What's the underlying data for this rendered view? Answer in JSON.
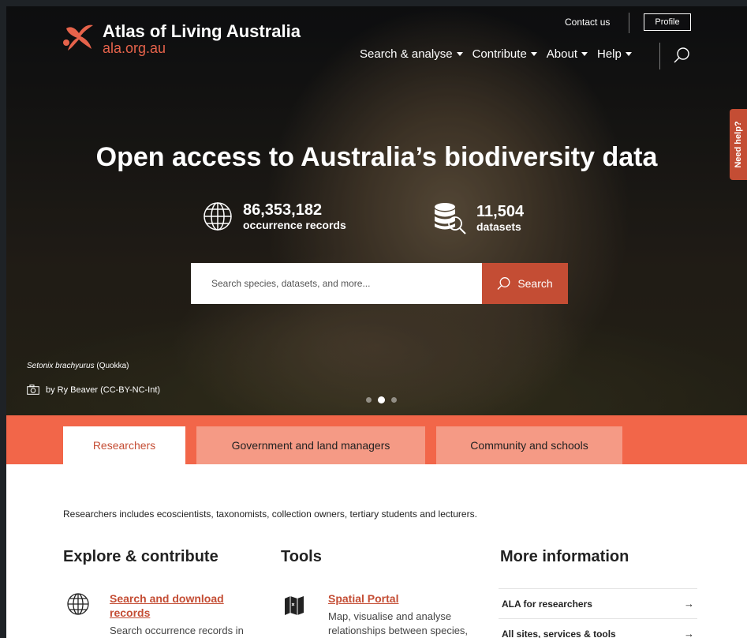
{
  "header": {
    "logo_title": "Atlas of Living Australia",
    "logo_subtitle": "ala.org.au",
    "contact_label": "Contact us",
    "profile_label": "Profile",
    "nav": [
      {
        "label": "Search & analyse"
      },
      {
        "label": "Contribute"
      },
      {
        "label": "About"
      },
      {
        "label": "Help"
      }
    ]
  },
  "hero": {
    "headline": "Open access to Australia’s biodiversity data",
    "stats": [
      {
        "number": "86,353,182",
        "label": "occurrence records",
        "icon": "globe-icon"
      },
      {
        "number": "11,504",
        "label": "datasets",
        "icon": "database-search-icon"
      }
    ],
    "search": {
      "placeholder": "Search species, datasets, and more...",
      "button_label": "Search"
    },
    "caption_species": "Setonix brachyurus",
    "caption_common": " (Quokka)",
    "caption_credit": "by Ry Beaver (CC-BY-NC-Int)",
    "slides": 3,
    "active_slide": 2
  },
  "need_help": "Need help?",
  "tabs": [
    {
      "label": "Researchers",
      "active": true
    },
    {
      "label": "Government and land managers",
      "active": false
    },
    {
      "label": "Community and schools",
      "active": false
    }
  ],
  "content": {
    "intro": "Researchers includes ecoscientists, taxonomists, collection owners, tertiary students and lecturers.",
    "columns": {
      "explore": {
        "heading": "Explore & contribute",
        "card_title_line1": "Search and download",
        "card_title_line2": "records",
        "card_desc": "Search occurrence records in"
      },
      "tools": {
        "heading": "Tools",
        "card_title": "Spatial Portal",
        "card_desc_line1": "Map, visualise and analyse",
        "card_desc_line2": "relationships between species,"
      },
      "more": {
        "heading": "More information",
        "items": [
          {
            "label": "ALA for researchers",
            "arrow": "→"
          },
          {
            "label": "All sites, services & tools",
            "arrow": "→"
          }
        ]
      }
    }
  },
  "colors": {
    "brand_orange": "#f26649",
    "brand_red": "#c44d34",
    "tab_inactive": "#f59a85"
  }
}
